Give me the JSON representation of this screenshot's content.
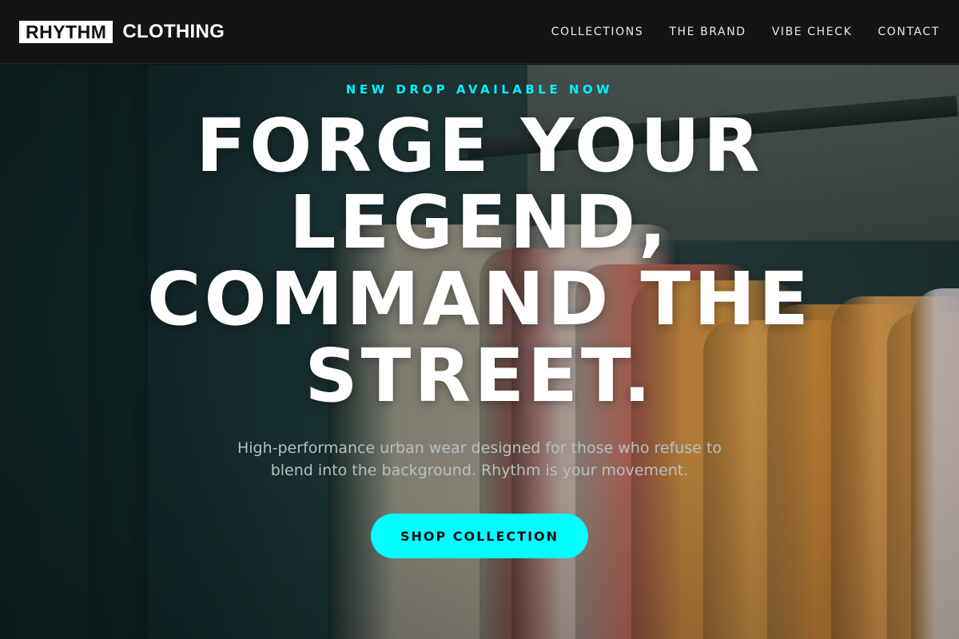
{
  "header": {
    "logo_box": "RHYTHM",
    "logo_text": "CLOTHING",
    "nav": [
      "COLLECTIONS",
      "THE BRAND",
      "VIBE CHECK",
      "CONTACT"
    ]
  },
  "hero": {
    "eyebrow": "NEW DROP AVAILABLE NOW",
    "headline": "FORGE YOUR LEGEND, COMMAND THE STREET.",
    "subtext": "High-performance urban wear designed for those who refuse to blend into the background. Rhythm is your movement.",
    "cta_label": "SHOP COLLECTION"
  },
  "colors": {
    "accent": "#00ffff",
    "header_bg": "#141414",
    "text": "#ffffff"
  }
}
